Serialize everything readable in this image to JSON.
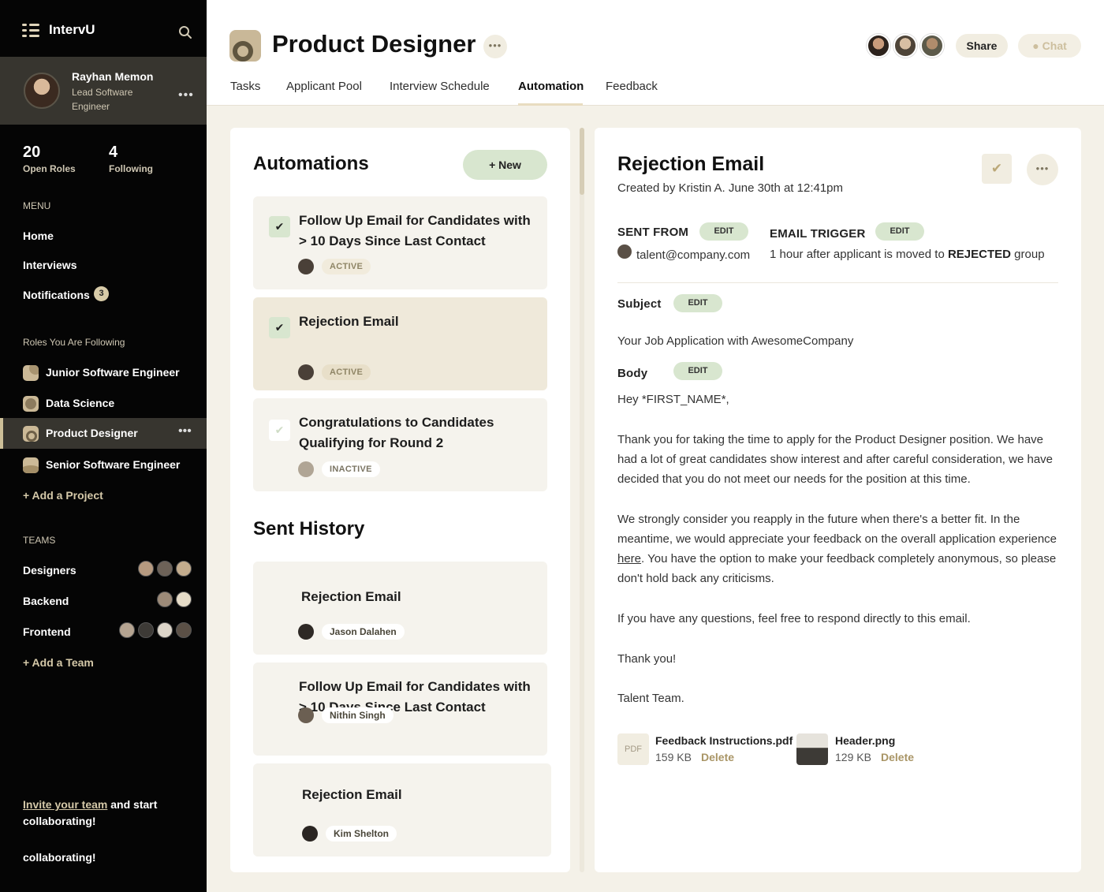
{
  "app": {
    "name": "IntervU"
  },
  "profile": {
    "name": "Rayhan Memon",
    "role": "Lead Software Engineer"
  },
  "stats": [
    {
      "value": "20",
      "label": "Open Roles"
    },
    {
      "value": "4",
      "label": "Following"
    }
  ],
  "menu": {
    "heading": "MENU",
    "items": [
      {
        "label": "Home"
      },
      {
        "label": "Interviews"
      },
      {
        "label": "Notifications",
        "badge": "3"
      }
    ]
  },
  "roles": {
    "heading": "Roles You Are Following",
    "items": [
      {
        "label": "Junior Software Engineer"
      },
      {
        "label": "Data Science"
      },
      {
        "label": "Product Designer",
        "active": true
      },
      {
        "label": "Senior Software Engineer"
      }
    ],
    "add_label": "+ Add a Project"
  },
  "teams": {
    "heading": "TEAMS",
    "items": [
      {
        "label": "Designers"
      },
      {
        "label": "Backend"
      },
      {
        "label": "Frontend"
      }
    ],
    "add_label": "+ Add a Team"
  },
  "invite": {
    "link": "Invite your team",
    "rest": " and start collaborating!",
    "ghost": "collaborating!"
  },
  "header": {
    "title": "Product Designer",
    "share_label": "Share",
    "chat_label": "Chat",
    "tabs": [
      {
        "label": "Tasks"
      },
      {
        "label": "Applicant Pool"
      },
      {
        "label": "Interview Schedule"
      },
      {
        "label": "Automation",
        "active": true
      },
      {
        "label": "Feedback"
      }
    ]
  },
  "automations": {
    "title": "Automations",
    "new_label": "+ New",
    "items": [
      {
        "title": "Follow Up Email for Candidates with > 10 Days Since Last Contact",
        "status": "ACTIVE",
        "checked": true
      },
      {
        "title": "Rejection Email",
        "status": "ACTIVE",
        "checked": true,
        "selected": true
      },
      {
        "title": "Congratulations to Candidates Qualifying for Round 2",
        "status": "INACTIVE",
        "checked": false
      }
    ]
  },
  "history": {
    "title": "Sent History",
    "items": [
      {
        "title": "Rejection Email",
        "person": "Jason Dalahen"
      },
      {
        "title": "Follow Up Email for Candidates with > 10 Days Since Last Contact",
        "person": "Nithin Singh"
      },
      {
        "title": "Rejection Email",
        "person": "Kim Shelton"
      }
    ]
  },
  "detail": {
    "title": "Rejection Email",
    "meta": "Created by Kristin A. June 30th at 12:41pm",
    "edit_label": "EDIT",
    "sent_from": {
      "label": "SENT FROM",
      "value": "talent@company.com"
    },
    "trigger": {
      "label": "EMAIL TRIGGER",
      "before": "1 hour after applicant is moved to ",
      "group": "REJECTED",
      "after": " group"
    },
    "subject": {
      "label": "Subject",
      "value": "Your Job Application with AwesomeCompany"
    },
    "body": {
      "label": "Body",
      "greeting": "Hey *FIRST_NAME*,",
      "p1": "Thank you for taking the time to apply for the Product Designer position. We have had a lot of great candidates show interest and after careful consideration, we have decided that you do not meet our needs for the position at this time.",
      "p2_before": "We strongly consider you reapply in the future when there's a better fit. In the meantime, we would appreciate your feedback on the overall application experience ",
      "p2_link": "here",
      "p2_after": ". You have the option to make your feedback completely anonymous, so please don't hold back any criticisms.",
      "p3": "If you have any questions, feel free to respond directly to this email.",
      "p4": "Thank you!",
      "p5": "Talent Team."
    },
    "attachments": [
      {
        "name": "Feedback Instructions.pdf",
        "size": "159 KB",
        "delete_label": "Delete",
        "thumb": "PDF"
      },
      {
        "name": "Header.png",
        "size": "129 KB",
        "delete_label": "Delete"
      }
    ]
  },
  "colors": {
    "accent_green": "#d8e6cf",
    "accent_tan": "#cdbf98",
    "sidebar_bg": "#050505"
  }
}
